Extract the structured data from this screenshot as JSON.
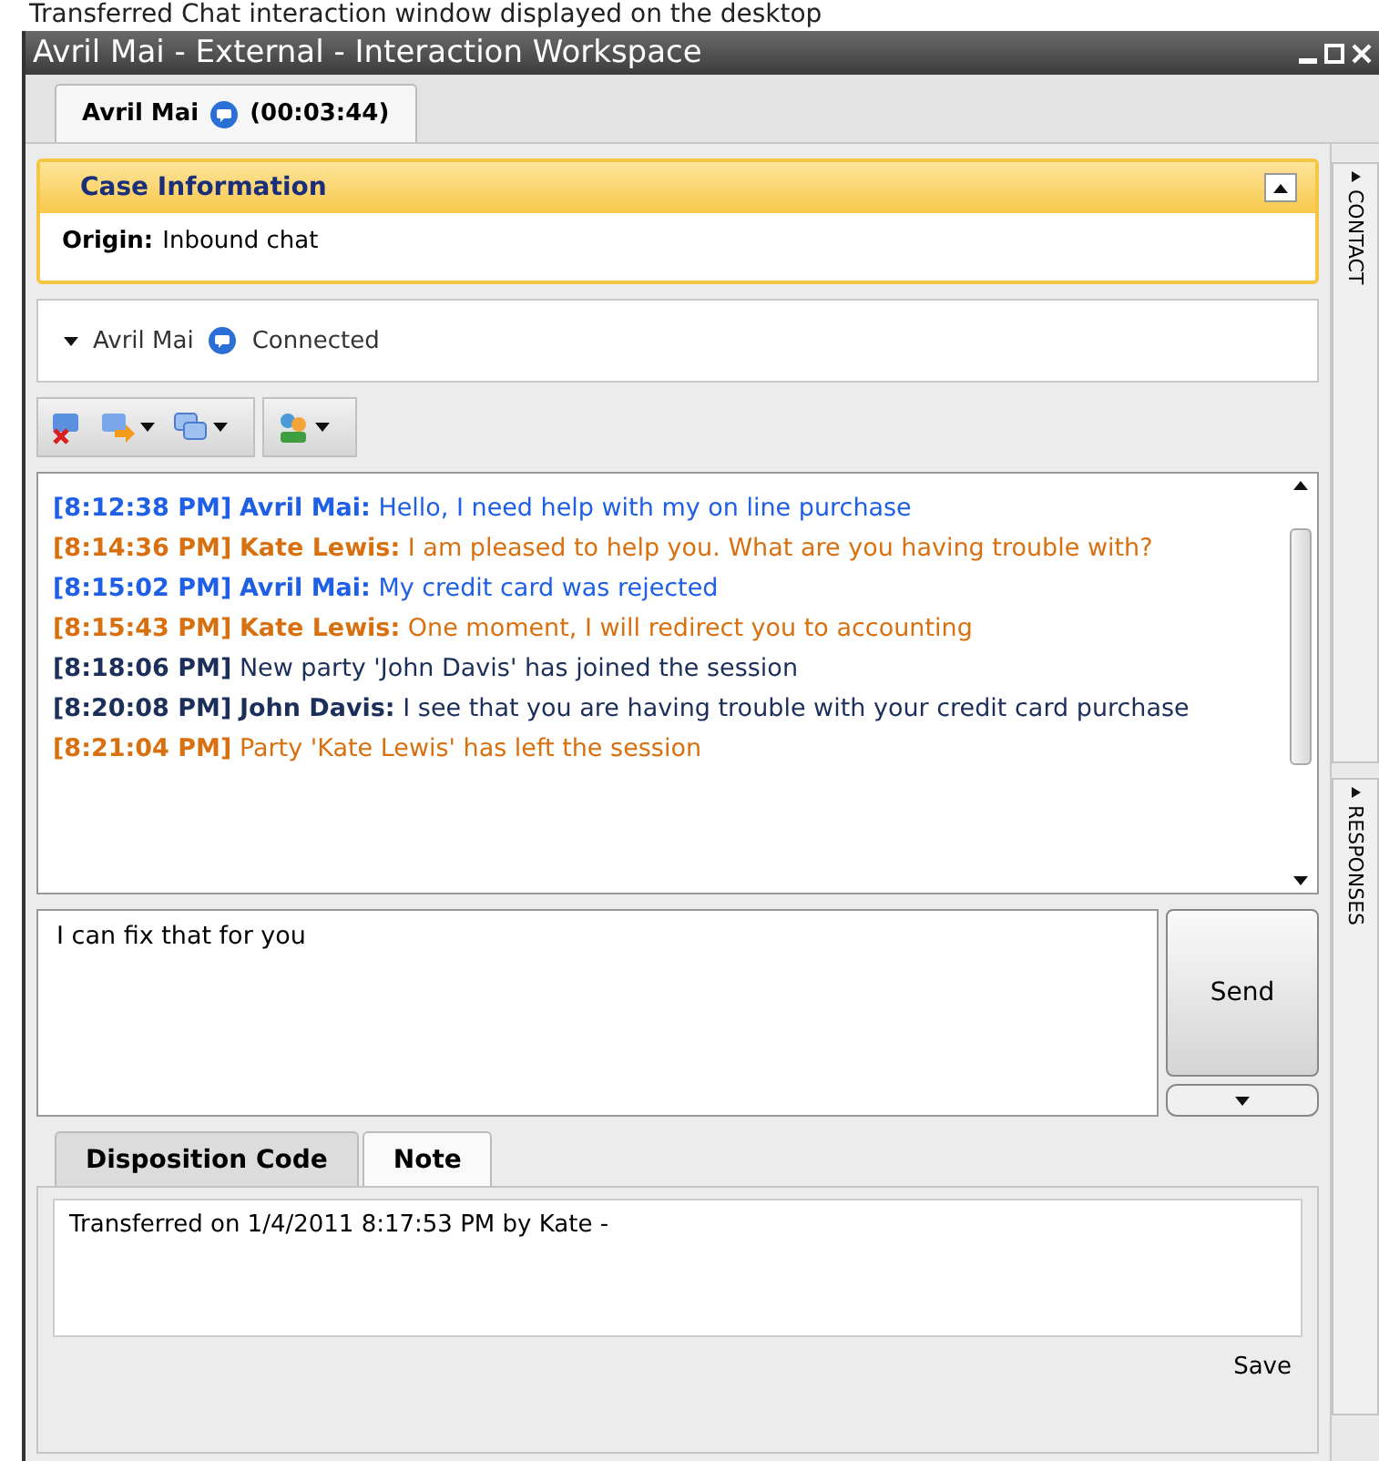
{
  "caption": "Transferred Chat interaction window displayed on the desktop",
  "window": {
    "title": "Avril Mai - External - Interaction Workspace"
  },
  "tabs": [
    {
      "label": "Avril Mai",
      "timer": "(00:03:44)",
      "selected": true
    }
  ],
  "case_information": {
    "title": "Case Information",
    "expanded": true,
    "fields": [
      {
        "label": "Origin:",
        "value": "Inbound chat"
      }
    ]
  },
  "party": {
    "name": "Avril Mai",
    "status": "Connected",
    "expanded": true
  },
  "transcript": [
    {
      "time": "[8:12:38 PM]",
      "sender": "Avril Mai:",
      "text": "Hello, I need help with my on line purchase",
      "color": "#1e5fe6"
    },
    {
      "time": "[8:14:36 PM]",
      "sender": "Kate Lewis:",
      "text": "I am pleased to help you. What are you having trouble with?",
      "color": "#d9700f"
    },
    {
      "time": "[8:15:02 PM]",
      "sender": "Avril Mai:",
      "text": "My credit card was rejected",
      "color": "#1e5fe6"
    },
    {
      "time": "[8:15:43 PM]",
      "sender": "Kate Lewis:",
      "text": "One moment, I will redirect you to accounting",
      "color": "#d9700f"
    },
    {
      "time": "[8:18:06 PM]",
      "text": "New party 'John Davis' has joined the session",
      "color": "#1c2f5a"
    },
    {
      "time": "[8:20:08 PM]",
      "sender": "John Davis:",
      "text": "I see that you are having trouble with your credit card purchase",
      "color": "#1c2f5a"
    },
    {
      "time": "[8:21:04 PM]",
      "text": "Party 'Kate Lewis' has left the session",
      "color": "#d9700f"
    }
  ],
  "message_input": {
    "value": "I can fix that for you"
  },
  "send_button": "Send",
  "bottom_tabs": [
    {
      "label": "Disposition Code",
      "selected": false
    },
    {
      "label": "Note",
      "selected": true
    }
  ],
  "note": {
    "value": "Transferred on 1/4/2011 8:17:53 PM by Kate -"
  },
  "save_button": "Save",
  "side_tabs": [
    {
      "label": "CONTACT"
    },
    {
      "label": "RESPONSES"
    }
  ]
}
